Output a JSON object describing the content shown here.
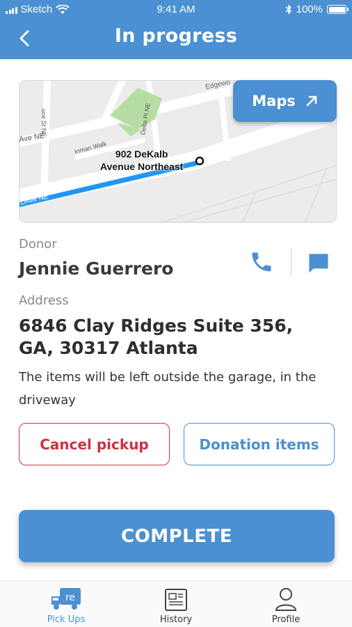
{
  "status": {
    "carrier": "Sketch",
    "time": "9:41 AM",
    "battery": "100%"
  },
  "header": {
    "title": "In progress"
  },
  "map": {
    "street_labels": [
      "Edgewo",
      "Ave NE",
      "Inman Walk",
      "Delta Pl NE",
      "uce St NE",
      "DAve NE"
    ],
    "address_line1": "902 DeKalb",
    "address_line2": "Avenue Northeast",
    "maps_label": "Maps"
  },
  "donor": {
    "label": "Donor",
    "name": "Jennie Guerrero"
  },
  "address": {
    "label": "Address",
    "line1": "6846 Clay Ridges Suite 356,",
    "line2": "GA, 30317 Atlanta",
    "note": "The items will be left outside the garage, in the driveway"
  },
  "actions": {
    "cancel": "Cancel pickup",
    "items": "Donation items",
    "complete": "COMPLETE"
  },
  "tabs": [
    {
      "label": "Pick Ups",
      "icon_text": "re"
    },
    {
      "label": "History"
    },
    {
      "label": "Profile"
    }
  ],
  "colors": {
    "primary": "#4a90d2",
    "danger": "#d0303f",
    "route": "#2196f3"
  }
}
